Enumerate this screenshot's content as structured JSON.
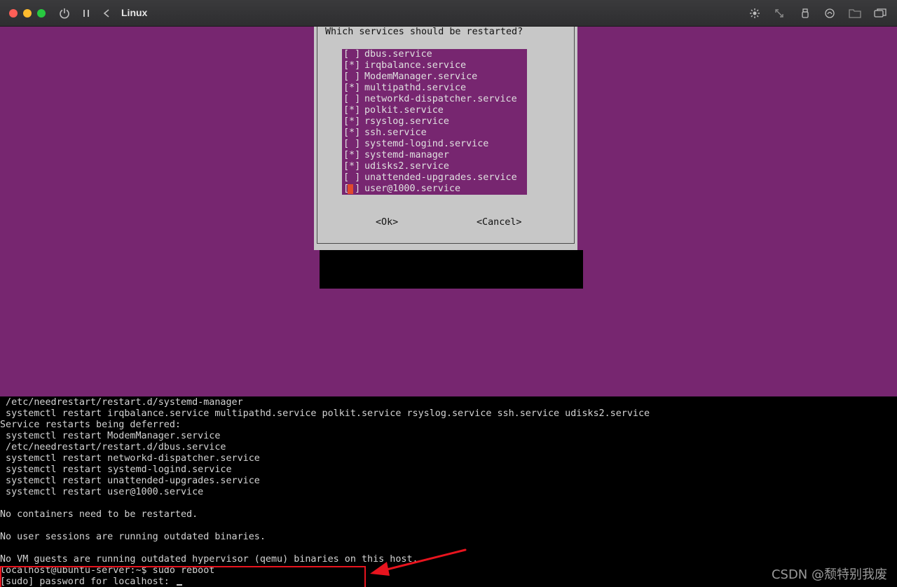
{
  "window": {
    "title": "Linux",
    "icons": [
      "power-icon",
      "pause-icon",
      "back-icon",
      "brightness-icon",
      "resize-icon",
      "usb-icon",
      "sound-icon",
      "folder-icon",
      "windows-icon"
    ]
  },
  "dialog": {
    "question": "Which services should be restarted?",
    "services": [
      {
        "mark": "[ ]",
        "name": "dbus.service"
      },
      {
        "mark": "[*]",
        "name": "irqbalance.service"
      },
      {
        "mark": "[ ]",
        "name": "ModemManager.service"
      },
      {
        "mark": "[*]",
        "name": "multipathd.service"
      },
      {
        "mark": "[ ]",
        "name": "networkd-dispatcher.service"
      },
      {
        "mark": "[*]",
        "name": "polkit.service"
      },
      {
        "mark": "[*]",
        "name": "rsyslog.service"
      },
      {
        "mark": "[*]",
        "name": "ssh.service"
      },
      {
        "mark": "[ ]",
        "name": "systemd-logind.service"
      },
      {
        "mark": "[*]",
        "name": "systemd-manager"
      },
      {
        "mark": "[*]",
        "name": "udisks2.service"
      },
      {
        "mark": "[ ]",
        "name": "unattended-upgrades.service"
      },
      {
        "mark": "[ ]",
        "name": "user@1000.service"
      }
    ],
    "ok_label": "<Ok>",
    "cancel_label": "<Cancel>"
  },
  "terminal": {
    "lines": [
      " /etc/needrestart/restart.d/systemd-manager",
      " systemctl restart irqbalance.service multipathd.service polkit.service rsyslog.service ssh.service udisks2.service",
      "Service restarts being deferred:",
      " systemctl restart ModemManager.service",
      " /etc/needrestart/restart.d/dbus.service",
      " systemctl restart networkd-dispatcher.service",
      " systemctl restart systemd-logind.service",
      " systemctl restart unattended-upgrades.service",
      " systemctl restart user@1000.service",
      "",
      "No containers need to be restarted.",
      "",
      "No user sessions are running outdated binaries.",
      "",
      "No VM guests are running outdated hypervisor (qemu) binaries on this host.",
      "localhost@ubuntu-server:~$ sudo reboot",
      "[sudo] password for localhost: "
    ]
  },
  "watermark": "CSDN @颓特别我废",
  "colors": {
    "console_bg": "#772670",
    "dialog_bg": "#c7c7c7",
    "annotation": "#e8141e"
  }
}
